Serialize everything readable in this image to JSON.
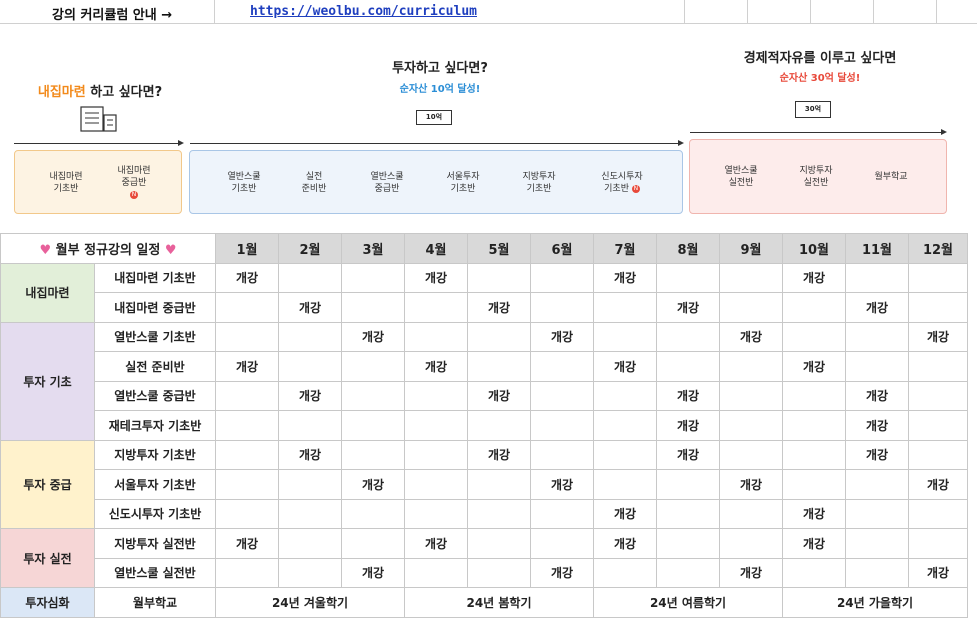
{
  "top": {
    "label": "강의 커리큘럼 안내 →",
    "link": "https://weolbu.com/curriculum"
  },
  "curriculum": {
    "group1": {
      "title_highlight": "내집마련",
      "title_rest": " 하고 싶다면?"
    },
    "group2": {
      "title": "투자하고 싶다면?",
      "sub": "순자산 10억 달성!",
      "money": "10억"
    },
    "group3": {
      "title": "경제적자유를 이루고 싶다면",
      "sub": "순자산 30억 달성!",
      "money": "30억"
    },
    "new_badge": "N",
    "courses1": [
      {
        "l1": "내집마련",
        "l2": "기초반"
      },
      {
        "l1": "내집마련",
        "l2": "중급반"
      }
    ],
    "courses2": [
      {
        "l1": "열반스쿨",
        "l2": "기초반"
      },
      {
        "l1": "실전",
        "l2": "준비반"
      },
      {
        "l1": "열반스쿨",
        "l2": "중급반"
      },
      {
        "l1": "서울투자",
        "l2": "기초반"
      },
      {
        "l1": "지방투자",
        "l2": "기초반"
      },
      {
        "l1": "신도시투자",
        "l2": "기초반"
      }
    ],
    "courses3": [
      {
        "l1": "열반스쿨",
        "l2": "실전반"
      },
      {
        "l1": "지방투자",
        "l2": "실전반"
      },
      {
        "l1": "월부학교",
        "l2": ""
      }
    ]
  },
  "schedule": {
    "title": "월부 정규강의 일정",
    "heart": "♥",
    "months": [
      "1월",
      "2월",
      "3월",
      "4월",
      "5월",
      "6월",
      "7월",
      "8월",
      "9월",
      "10월",
      "11월",
      "12월"
    ],
    "open": "개강",
    "categories": [
      {
        "name": "내집마련",
        "cls": "cat-a",
        "rows": [
          {
            "course": "내집마련 기초반",
            "open": [
              1,
              4,
              7,
              10
            ]
          },
          {
            "course": "내집마련 중급반",
            "open": [
              2,
              5,
              8,
              11
            ]
          }
        ]
      },
      {
        "name": "투자 기초",
        "cls": "cat-b",
        "rows": [
          {
            "course": "열반스쿨 기초반",
            "open": [
              3,
              6,
              9,
              12
            ]
          },
          {
            "course": "실전 준비반",
            "open": [
              1,
              4,
              7,
              10
            ]
          },
          {
            "course": "열반스쿨 중급반",
            "open": [
              2,
              5,
              8,
              11
            ]
          },
          {
            "course": "재테크투자 기초반",
            "open": [
              8,
              11
            ]
          }
        ]
      },
      {
        "name": "투자 중급",
        "cls": "cat-c",
        "rows": [
          {
            "course": "지방투자 기초반",
            "open": [
              2,
              5,
              8,
              11
            ]
          },
          {
            "course": "서울투자 기초반",
            "open": [
              3,
              6,
              9,
              12
            ]
          },
          {
            "course": "신도시투자 기초반",
            "open": [
              7,
              10
            ]
          }
        ]
      },
      {
        "name": "투자 실전",
        "cls": "cat-d",
        "rows": [
          {
            "course": "지방투자 실전반",
            "open": [
              1,
              4,
              7,
              10
            ]
          },
          {
            "course": "열반스쿨 실전반",
            "open": [
              3,
              6,
              9,
              12
            ]
          }
        ]
      }
    ],
    "last_row": {
      "category": "투자심화",
      "course": "월부학교",
      "terms": [
        {
          "label": "24년 겨울학기",
          "span": 3
        },
        {
          "label": "24년 봄학기",
          "span": 3
        },
        {
          "label": "24년 여름학기",
          "span": 3
        },
        {
          "label": "24년 가을학기",
          "span": 3
        }
      ]
    }
  }
}
